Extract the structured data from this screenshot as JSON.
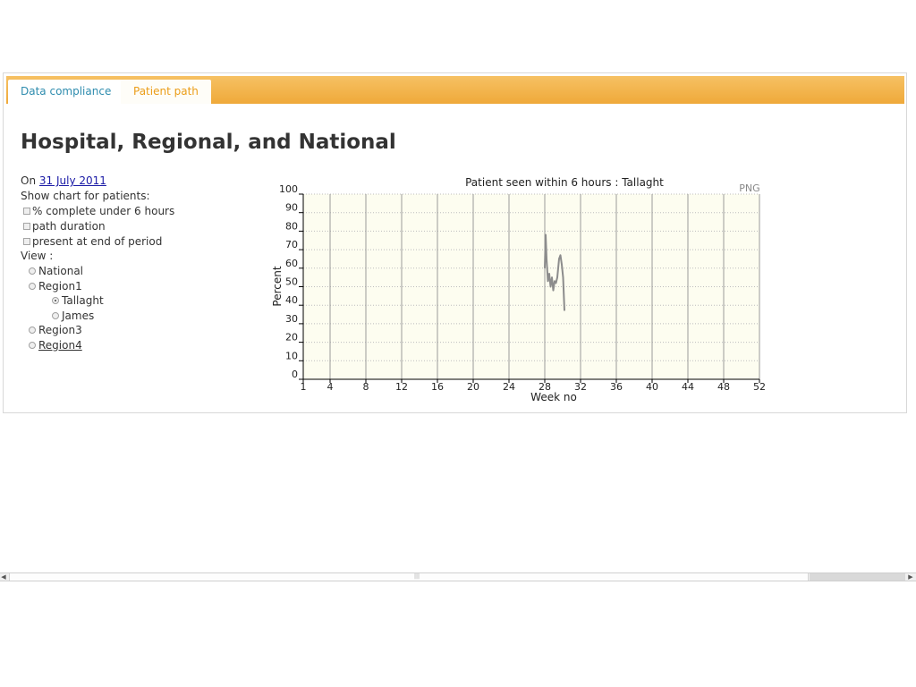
{
  "tabs": [
    {
      "label": "Data compliance"
    },
    {
      "label": "Patient path"
    }
  ],
  "page_title": "Hospital, Regional, and National",
  "sidebar": {
    "on_label": "On",
    "date_link": "31 July 2011",
    "show_chart_label": "Show chart for patients:",
    "checkboxes": [
      {
        "label": "% complete under 6 hours",
        "checked": false
      },
      {
        "label": "path duration",
        "checked": false
      },
      {
        "label": "present at end of period",
        "checked": false
      }
    ],
    "view_label": "View :",
    "view_options": [
      {
        "label": "National",
        "selected": false
      },
      {
        "label": "Region1",
        "selected": false
      },
      {
        "label": "Tallaght",
        "selected": true
      },
      {
        "label": "James",
        "selected": false
      },
      {
        "label": "Region3",
        "selected": false
      },
      {
        "label": "Region4",
        "selected": false
      }
    ]
  },
  "png_label": "PNG",
  "chart_data": {
    "type": "line",
    "title": "Patient seen within 6 hours : Tallaght",
    "xlabel": "Week no",
    "ylabel": "Percent",
    "xlim": [
      1,
      52
    ],
    "ylim": [
      0,
      100
    ],
    "x_ticks": [
      1,
      4,
      8,
      12,
      16,
      20,
      24,
      28,
      32,
      36,
      40,
      44,
      48,
      52
    ],
    "y_ticks": [
      0,
      10,
      20,
      30,
      40,
      50,
      60,
      70,
      80,
      90,
      100
    ],
    "grid": true,
    "series": [
      {
        "color": "#8c8c8c",
        "x": [
          28.0,
          28.1,
          28.2,
          28.35,
          28.5,
          28.65,
          28.8,
          28.95,
          29.1,
          29.25,
          29.4,
          29.6,
          29.75,
          29.9,
          30.05,
          30.2
        ],
        "y": [
          60,
          78,
          65,
          53,
          57,
          50,
          55,
          48,
          53,
          52,
          55,
          65,
          67,
          62,
          55,
          37
        ]
      }
    ],
    "colors": {
      "plot_bg": "#fdfdf0",
      "grid_major": "#9a9a9a",
      "grid_minor": "#bdbdbd",
      "line": "#8c8c8c"
    }
  }
}
